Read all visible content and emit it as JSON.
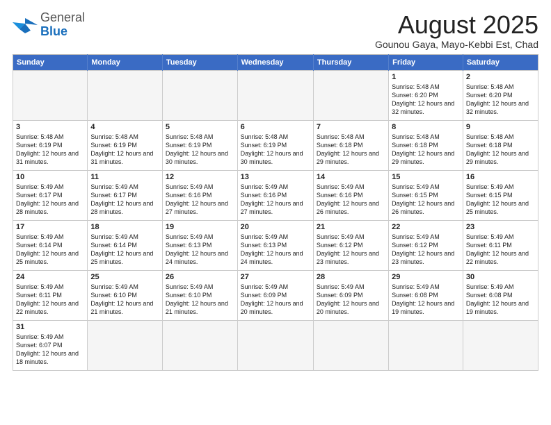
{
  "header": {
    "logo_general": "General",
    "logo_blue": "Blue",
    "month_title": "August 2025",
    "location": "Gounou Gaya, Mayo-Kebbi Est, Chad"
  },
  "weekdays": [
    "Sunday",
    "Monday",
    "Tuesday",
    "Wednesday",
    "Thursday",
    "Friday",
    "Saturday"
  ],
  "weeks": [
    [
      {
        "day": "",
        "info": ""
      },
      {
        "day": "",
        "info": ""
      },
      {
        "day": "",
        "info": ""
      },
      {
        "day": "",
        "info": ""
      },
      {
        "day": "",
        "info": ""
      },
      {
        "day": "1",
        "info": "Sunrise: 5:48 AM\nSunset: 6:20 PM\nDaylight: 12 hours and 32 minutes."
      },
      {
        "day": "2",
        "info": "Sunrise: 5:48 AM\nSunset: 6:20 PM\nDaylight: 12 hours and 32 minutes."
      }
    ],
    [
      {
        "day": "3",
        "info": "Sunrise: 5:48 AM\nSunset: 6:19 PM\nDaylight: 12 hours and 31 minutes."
      },
      {
        "day": "4",
        "info": "Sunrise: 5:48 AM\nSunset: 6:19 PM\nDaylight: 12 hours and 31 minutes."
      },
      {
        "day": "5",
        "info": "Sunrise: 5:48 AM\nSunset: 6:19 PM\nDaylight: 12 hours and 30 minutes."
      },
      {
        "day": "6",
        "info": "Sunrise: 5:48 AM\nSunset: 6:19 PM\nDaylight: 12 hours and 30 minutes."
      },
      {
        "day": "7",
        "info": "Sunrise: 5:48 AM\nSunset: 6:18 PM\nDaylight: 12 hours and 29 minutes."
      },
      {
        "day": "8",
        "info": "Sunrise: 5:48 AM\nSunset: 6:18 PM\nDaylight: 12 hours and 29 minutes."
      },
      {
        "day": "9",
        "info": "Sunrise: 5:48 AM\nSunset: 6:18 PM\nDaylight: 12 hours and 29 minutes."
      }
    ],
    [
      {
        "day": "10",
        "info": "Sunrise: 5:49 AM\nSunset: 6:17 PM\nDaylight: 12 hours and 28 minutes."
      },
      {
        "day": "11",
        "info": "Sunrise: 5:49 AM\nSunset: 6:17 PM\nDaylight: 12 hours and 28 minutes."
      },
      {
        "day": "12",
        "info": "Sunrise: 5:49 AM\nSunset: 6:16 PM\nDaylight: 12 hours and 27 minutes."
      },
      {
        "day": "13",
        "info": "Sunrise: 5:49 AM\nSunset: 6:16 PM\nDaylight: 12 hours and 27 minutes."
      },
      {
        "day": "14",
        "info": "Sunrise: 5:49 AM\nSunset: 6:16 PM\nDaylight: 12 hours and 26 minutes."
      },
      {
        "day": "15",
        "info": "Sunrise: 5:49 AM\nSunset: 6:15 PM\nDaylight: 12 hours and 26 minutes."
      },
      {
        "day": "16",
        "info": "Sunrise: 5:49 AM\nSunset: 6:15 PM\nDaylight: 12 hours and 25 minutes."
      }
    ],
    [
      {
        "day": "17",
        "info": "Sunrise: 5:49 AM\nSunset: 6:14 PM\nDaylight: 12 hours and 25 minutes."
      },
      {
        "day": "18",
        "info": "Sunrise: 5:49 AM\nSunset: 6:14 PM\nDaylight: 12 hours and 25 minutes."
      },
      {
        "day": "19",
        "info": "Sunrise: 5:49 AM\nSunset: 6:13 PM\nDaylight: 12 hours and 24 minutes."
      },
      {
        "day": "20",
        "info": "Sunrise: 5:49 AM\nSunset: 6:13 PM\nDaylight: 12 hours and 24 minutes."
      },
      {
        "day": "21",
        "info": "Sunrise: 5:49 AM\nSunset: 6:12 PM\nDaylight: 12 hours and 23 minutes."
      },
      {
        "day": "22",
        "info": "Sunrise: 5:49 AM\nSunset: 6:12 PM\nDaylight: 12 hours and 23 minutes."
      },
      {
        "day": "23",
        "info": "Sunrise: 5:49 AM\nSunset: 6:11 PM\nDaylight: 12 hours and 22 minutes."
      }
    ],
    [
      {
        "day": "24",
        "info": "Sunrise: 5:49 AM\nSunset: 6:11 PM\nDaylight: 12 hours and 22 minutes."
      },
      {
        "day": "25",
        "info": "Sunrise: 5:49 AM\nSunset: 6:10 PM\nDaylight: 12 hours and 21 minutes."
      },
      {
        "day": "26",
        "info": "Sunrise: 5:49 AM\nSunset: 6:10 PM\nDaylight: 12 hours and 21 minutes."
      },
      {
        "day": "27",
        "info": "Sunrise: 5:49 AM\nSunset: 6:09 PM\nDaylight: 12 hours and 20 minutes."
      },
      {
        "day": "28",
        "info": "Sunrise: 5:49 AM\nSunset: 6:09 PM\nDaylight: 12 hours and 20 minutes."
      },
      {
        "day": "29",
        "info": "Sunrise: 5:49 AM\nSunset: 6:08 PM\nDaylight: 12 hours and 19 minutes."
      },
      {
        "day": "30",
        "info": "Sunrise: 5:49 AM\nSunset: 6:08 PM\nDaylight: 12 hours and 19 minutes."
      }
    ],
    [
      {
        "day": "31",
        "info": "Sunrise: 5:49 AM\nSunset: 6:07 PM\nDaylight: 12 hours and 18 minutes."
      },
      {
        "day": "",
        "info": ""
      },
      {
        "day": "",
        "info": ""
      },
      {
        "day": "",
        "info": ""
      },
      {
        "day": "",
        "info": ""
      },
      {
        "day": "",
        "info": ""
      },
      {
        "day": "",
        "info": ""
      }
    ]
  ]
}
